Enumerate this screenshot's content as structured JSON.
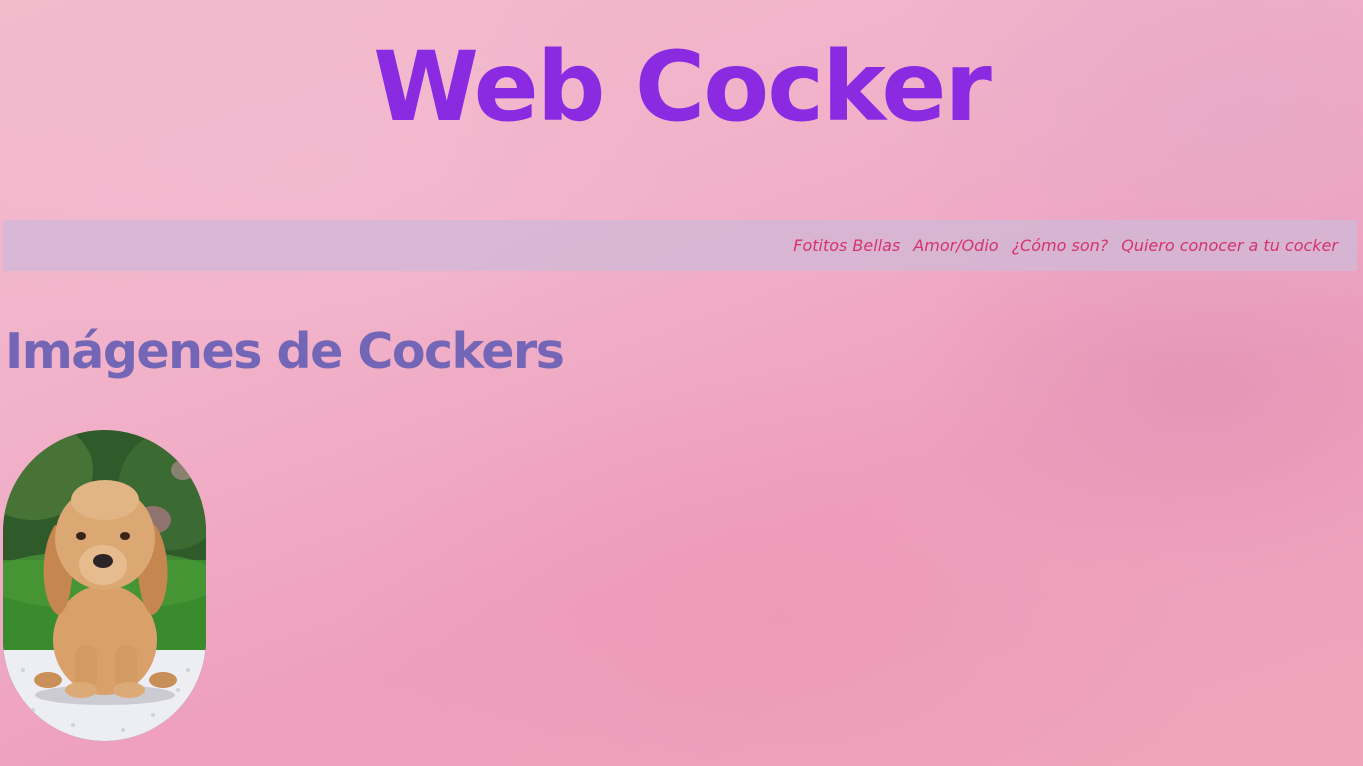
{
  "header": {
    "title": "Web Cocker"
  },
  "nav": {
    "items": [
      {
        "label": "Fotitos Bellas"
      },
      {
        "label": "Amor/Odio"
      },
      {
        "label": "¿Cómo son?"
      },
      {
        "label": "Quiero conocer a tu cocker"
      }
    ]
  },
  "main": {
    "heading": "Imágenes de Cockers",
    "image": {
      "subject": "cocker spaniel puppy"
    }
  },
  "colors": {
    "title": "#8a2be2",
    "heading": "#7466b6",
    "nav_link": "#d6336c",
    "nav_bar": "#d2b8d6"
  }
}
